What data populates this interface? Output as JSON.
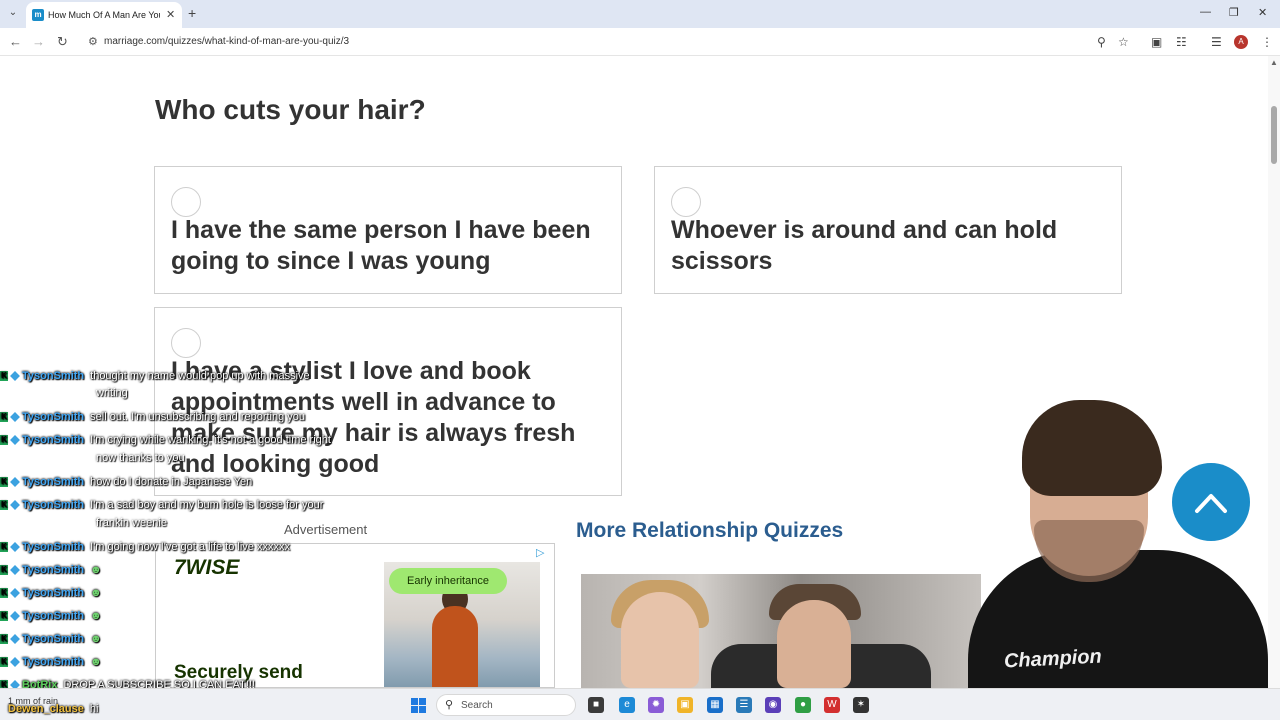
{
  "browser": {
    "tab_title": "How Much Of A Man Are You Q",
    "url": "marriage.com/quizzes/what-kind-of-man-are-you-quiz/3"
  },
  "quiz": {
    "question": "Who cuts your hair?",
    "options": [
      {
        "text": "I have the same person I have been going to since I was young"
      },
      {
        "text": "Whoever is around and can hold scissors"
      },
      {
        "text": "I have a stylist I love and book appointments well in advance to make sure my hair is always fresh and looking good"
      }
    ]
  },
  "ad": {
    "label": "Advertisement",
    "logo": "7WISE",
    "badge": "Early inheritance",
    "text": "Securely send"
  },
  "more": {
    "title": "More Relationship Quizzes"
  },
  "stream": {
    "logo": "Champion"
  },
  "chat": [
    {
      "user": "TysonSmith",
      "msg": "thought my name would pop up with massive",
      "cont": "writing"
    },
    {
      "user": "TysonSmith",
      "msg": "sell out. I'm unsubscribing and reporting you",
      "cont": ""
    },
    {
      "user": "TysonSmith",
      "msg": "I'm crying while wanking, it's not a good time right",
      "cont": "now thanks to you"
    },
    {
      "user": "TysonSmith",
      "msg": "how do I donate in Japanese Yen",
      "cont": ""
    },
    {
      "user": "TysonSmith",
      "msg": "I'm a sad boy and my bum hole is loose for your",
      "cont": "frankin weenie"
    },
    {
      "user": "TysonSmith",
      "msg": "I'm going now I've got a life to live xxxxxx",
      "cont": ""
    },
    {
      "user": "TysonSmith",
      "msg": "",
      "cont": ""
    },
    {
      "user": "TysonSmith",
      "msg": "",
      "cont": ""
    },
    {
      "user": "TysonSmith",
      "msg": "",
      "cont": ""
    },
    {
      "user": "TysonSmith",
      "msg": "",
      "cont": ""
    },
    {
      "user": "TysonSmith",
      "msg": "",
      "cont": ""
    },
    {
      "user": "BotRix",
      "msg": "DROP A SUBSCRIBE SO I CAN EAT!!!",
      "cont": ""
    },
    {
      "user": "Dewen_clause",
      "msg": "hi",
      "cont": ""
    }
  ],
  "taskbar": {
    "weather": "1 mm of rain",
    "search_label": "Search"
  },
  "colors": {
    "accent": "#1a8dc9",
    "link_heading": "#2b5d8f",
    "chat_user": "#41a7f5"
  }
}
